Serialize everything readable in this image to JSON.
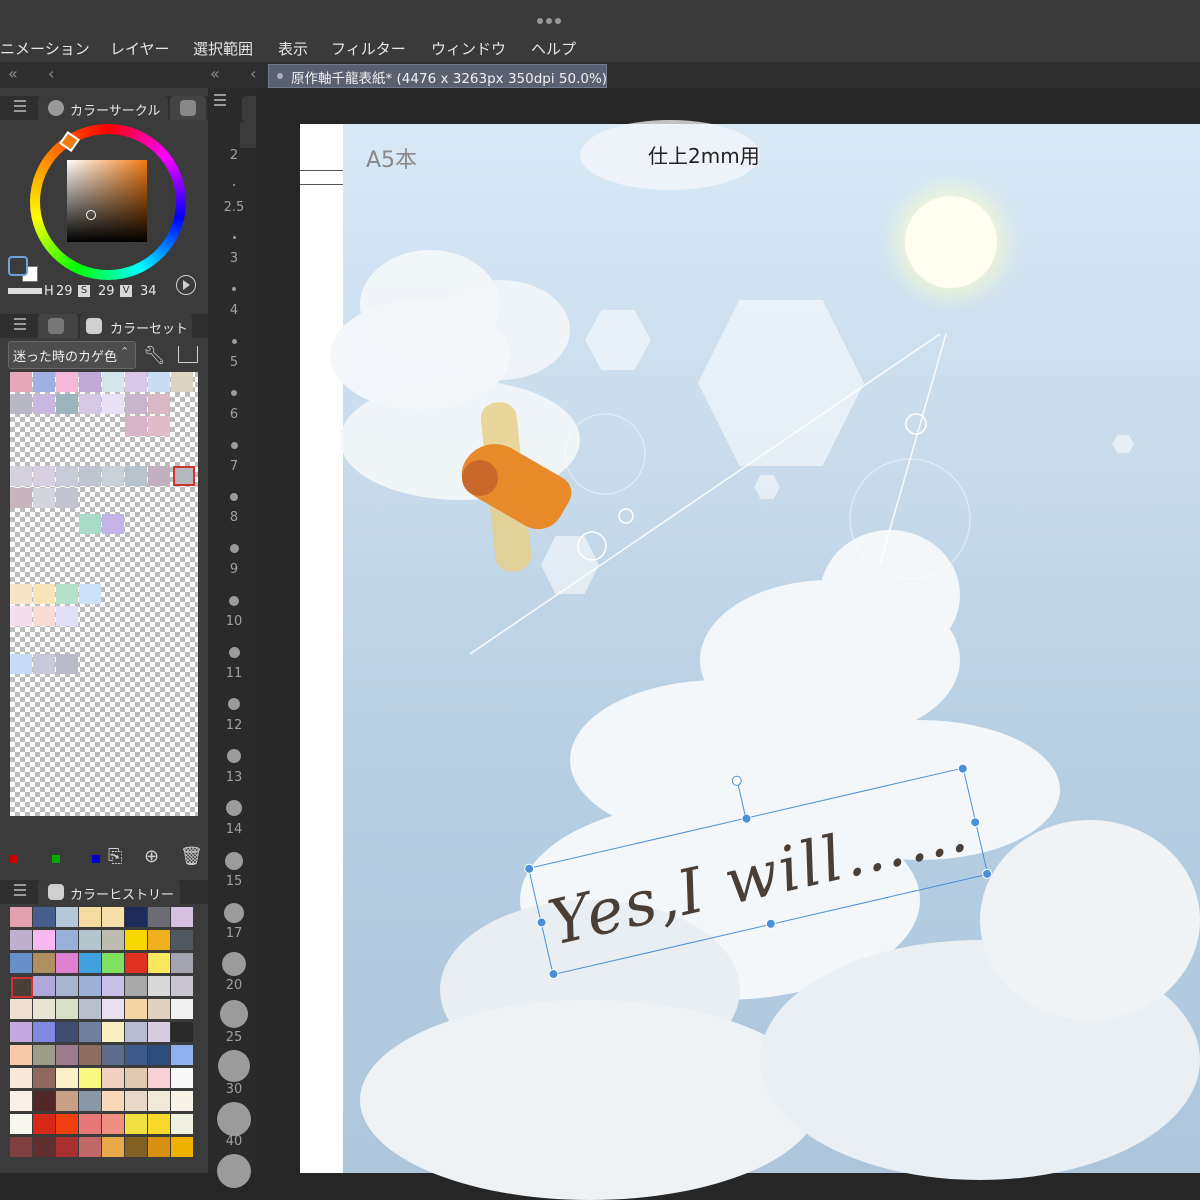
{
  "window": {
    "dots": "•••"
  },
  "menu": {
    "items": [
      "ニメーション",
      "レイヤー",
      "選択範囲",
      "表示",
      "フィルター",
      "ウィンドウ",
      "ヘルプ"
    ]
  },
  "tabs": {
    "left_chevrons": "«",
    "left_chevron": "‹",
    "right_chevrons": "«",
    "right_chevron": "‹",
    "document_title": "原作軸千龍表紙* (4476 x 3263px 350dpi 50.0%)"
  },
  "color_circle": {
    "tab_label": "カラーサークル",
    "values": {
      "h_prefix": "H",
      "h": "29",
      "s_label": "S",
      "s": "29",
      "v_label": "V",
      "v": "34"
    },
    "current_color": "#f07a10"
  },
  "color_set": {
    "tab_label": "カラーセット",
    "selected_set": "迷った時のカゲ色"
  },
  "color_history": {
    "tab_label": "カラーヒストリー"
  },
  "ruler": {
    "labels": [
      "2",
      "2.5",
      "3",
      "4",
      "5",
      "6",
      "7",
      "8",
      "9",
      "10",
      "11",
      "12",
      "13",
      "14",
      "15",
      "17",
      "20",
      "25",
      "30",
      "40"
    ]
  },
  "canvas": {
    "trim_text_left": "A5本",
    "trim_text_right": "仕上2mm用",
    "text_layer": "Yes,I will……"
  },
  "colors": {
    "accent": "#4a90d9",
    "panel_bg": "#3b3b3b",
    "menubar_bg": "#3a3a3a"
  }
}
